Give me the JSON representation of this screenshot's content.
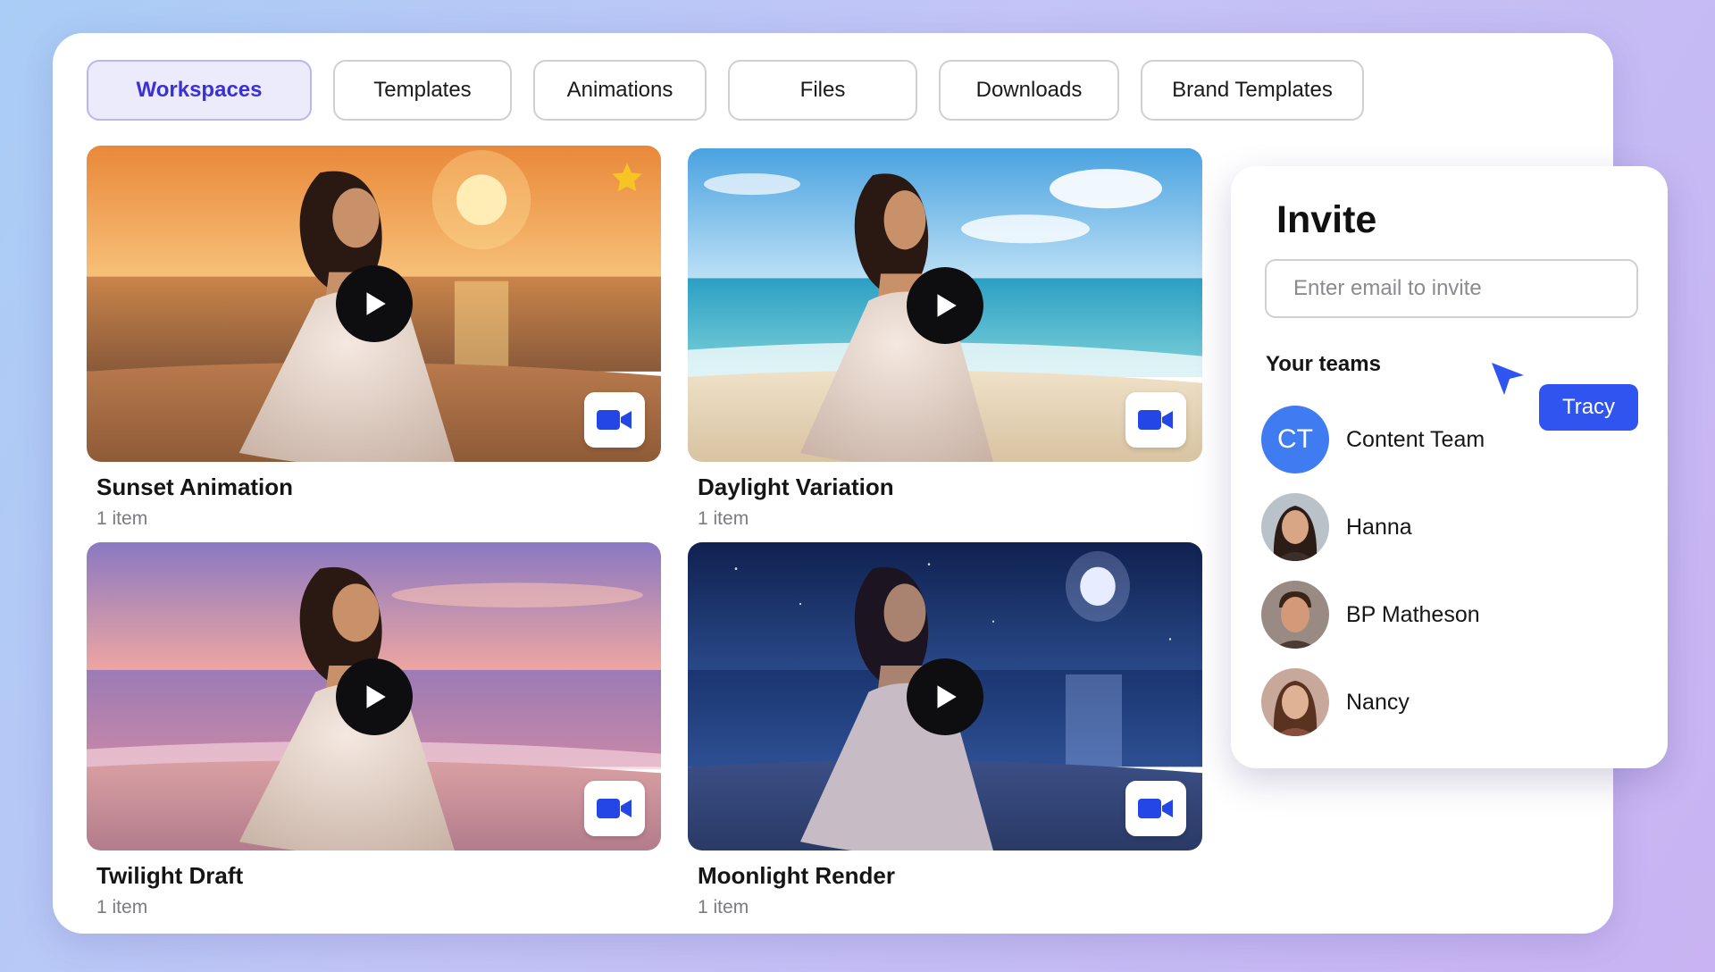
{
  "tabs": [
    {
      "label": "Workspaces",
      "active": true
    },
    {
      "label": "Templates",
      "active": false
    },
    {
      "label": "Animations",
      "active": false
    },
    {
      "label": "Files",
      "active": false
    },
    {
      "label": "Downloads",
      "active": false
    },
    {
      "label": "Brand Templates",
      "active": false
    }
  ],
  "cards": [
    {
      "title": "Sunset Animation",
      "count": "1 item",
      "scene": "sunset",
      "starred": true
    },
    {
      "title": "Daylight Variation",
      "count": "1 item",
      "scene": "daylight",
      "starred": false
    },
    {
      "title": "Twilight Draft",
      "count": "1 item",
      "scene": "twilight",
      "starred": false
    },
    {
      "title": "Moonlight Render",
      "count": "1 item",
      "scene": "moonlight",
      "starred": false
    }
  ],
  "invite": {
    "title": "Invite",
    "email_placeholder": "Enter email to invite",
    "email_value": "",
    "teams_label": "Your teams",
    "cursor_tag": "Tracy",
    "members": [
      {
        "name": "Content Team",
        "initials": "CT"
      },
      {
        "name": "Hanna",
        "initials": ""
      },
      {
        "name": "BP Matheson",
        "initials": ""
      },
      {
        "name": "Nancy",
        "initials": ""
      }
    ]
  },
  "colors": {
    "accent": "#3b2fd8",
    "active_tab_bg": "#ecebfb",
    "tag_blue": "#2f54f0",
    "team_avatar": "#3f7cf2",
    "star": "#f7c325",
    "camera_icon": "#2247e6"
  },
  "icons": {
    "play": "play-icon",
    "camera": "video-camera-icon",
    "star": "star-icon",
    "cursor": "pointer-cursor-icon"
  }
}
